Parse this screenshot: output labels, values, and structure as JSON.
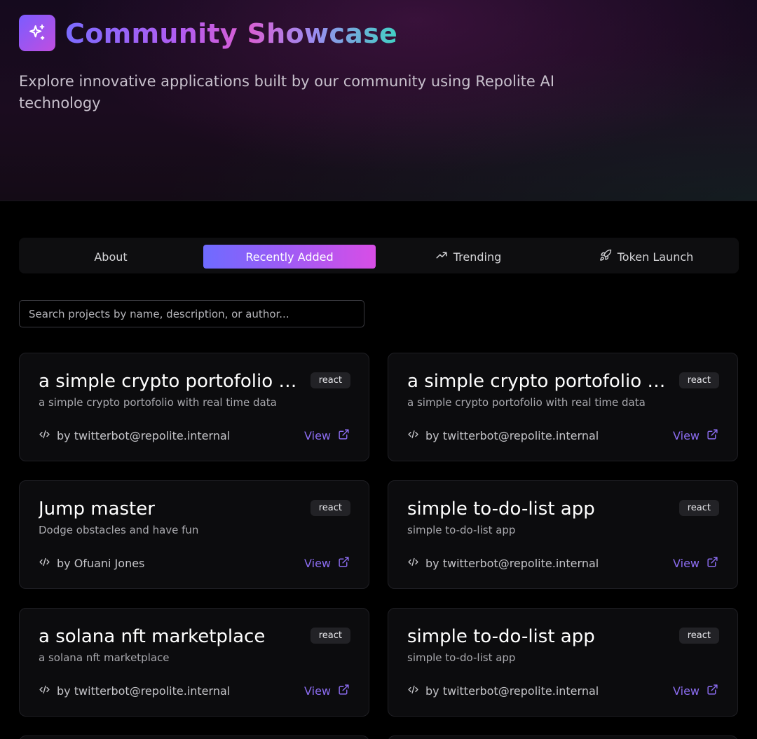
{
  "header": {
    "logo_icon": "sparkles-icon",
    "title": "Community Showcase",
    "subtitle": "Explore innovative applications built by our community using Repolite AI technology"
  },
  "tabs": [
    {
      "label": "About",
      "icon": "",
      "active": false
    },
    {
      "label": "Recently Added",
      "icon": "",
      "active": true
    },
    {
      "label": "Trending",
      "icon": "trending-up-icon",
      "active": false
    },
    {
      "label": "Token Launch",
      "icon": "rocket-icon",
      "active": false
    }
  ],
  "search": {
    "placeholder": "Search projects by name, description, or author...",
    "value": ""
  },
  "projects": [
    {
      "title": "a simple crypto portofolio with real time data",
      "badge": "react",
      "description": "a simple crypto portofolio with real time data",
      "author": "by twitterbot@repolite.internal",
      "view_label": "View"
    },
    {
      "title": "a simple crypto portofolio with real time data",
      "badge": "react",
      "description": "a simple crypto portofolio with real time data",
      "author": "by twitterbot@repolite.internal",
      "view_label": "View"
    },
    {
      "title": "Jump master",
      "badge": "react",
      "description": "Dodge obstacles and have fun",
      "author": "by Ofuani Jones",
      "view_label": "View"
    },
    {
      "title": "simple to-do-list app",
      "badge": "react",
      "description": "simple to-do-list app",
      "author": "by twitterbot@repolite.internal",
      "view_label": "View"
    },
    {
      "title": "a solana nft marketplace",
      "badge": "react",
      "description": "a solana nft marketplace",
      "author": "by twitterbot@repolite.internal",
      "view_label": "View"
    },
    {
      "title": "simple to-do-list app",
      "badge": "react",
      "description": "simple to-do-list app",
      "author": "by twitterbot@repolite.internal",
      "view_label": "View"
    }
  ],
  "colors": {
    "accent_purple": "#8b6cf0",
    "tab_active_start": "#6e6bff",
    "tab_active_end": "#d84ee6",
    "background": "#000000",
    "card_background": "#0c0c0e"
  }
}
